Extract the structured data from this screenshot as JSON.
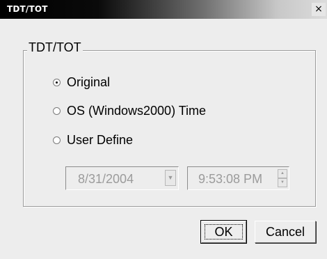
{
  "window": {
    "title": "TDT/TOT",
    "close_glyph": "×"
  },
  "group": {
    "legend": "TDT/TOT"
  },
  "options": [
    {
      "label": "Original",
      "selected": true
    },
    {
      "label": "OS (Windows2000) Time",
      "selected": false
    },
    {
      "label": "User Define",
      "selected": false
    }
  ],
  "date_picker": {
    "value": "8/31/2004",
    "enabled": false,
    "icon": "chevron-down-icon"
  },
  "time_picker": {
    "value": "9:53:08 PM",
    "enabled": false,
    "icons": [
      "spin-up-icon",
      "spin-down-icon"
    ]
  },
  "buttons": {
    "ok": "OK",
    "cancel": "Cancel"
  },
  "colors": {
    "dialog_bg": "#ededed",
    "disabled_text": "#9b9b9b"
  }
}
